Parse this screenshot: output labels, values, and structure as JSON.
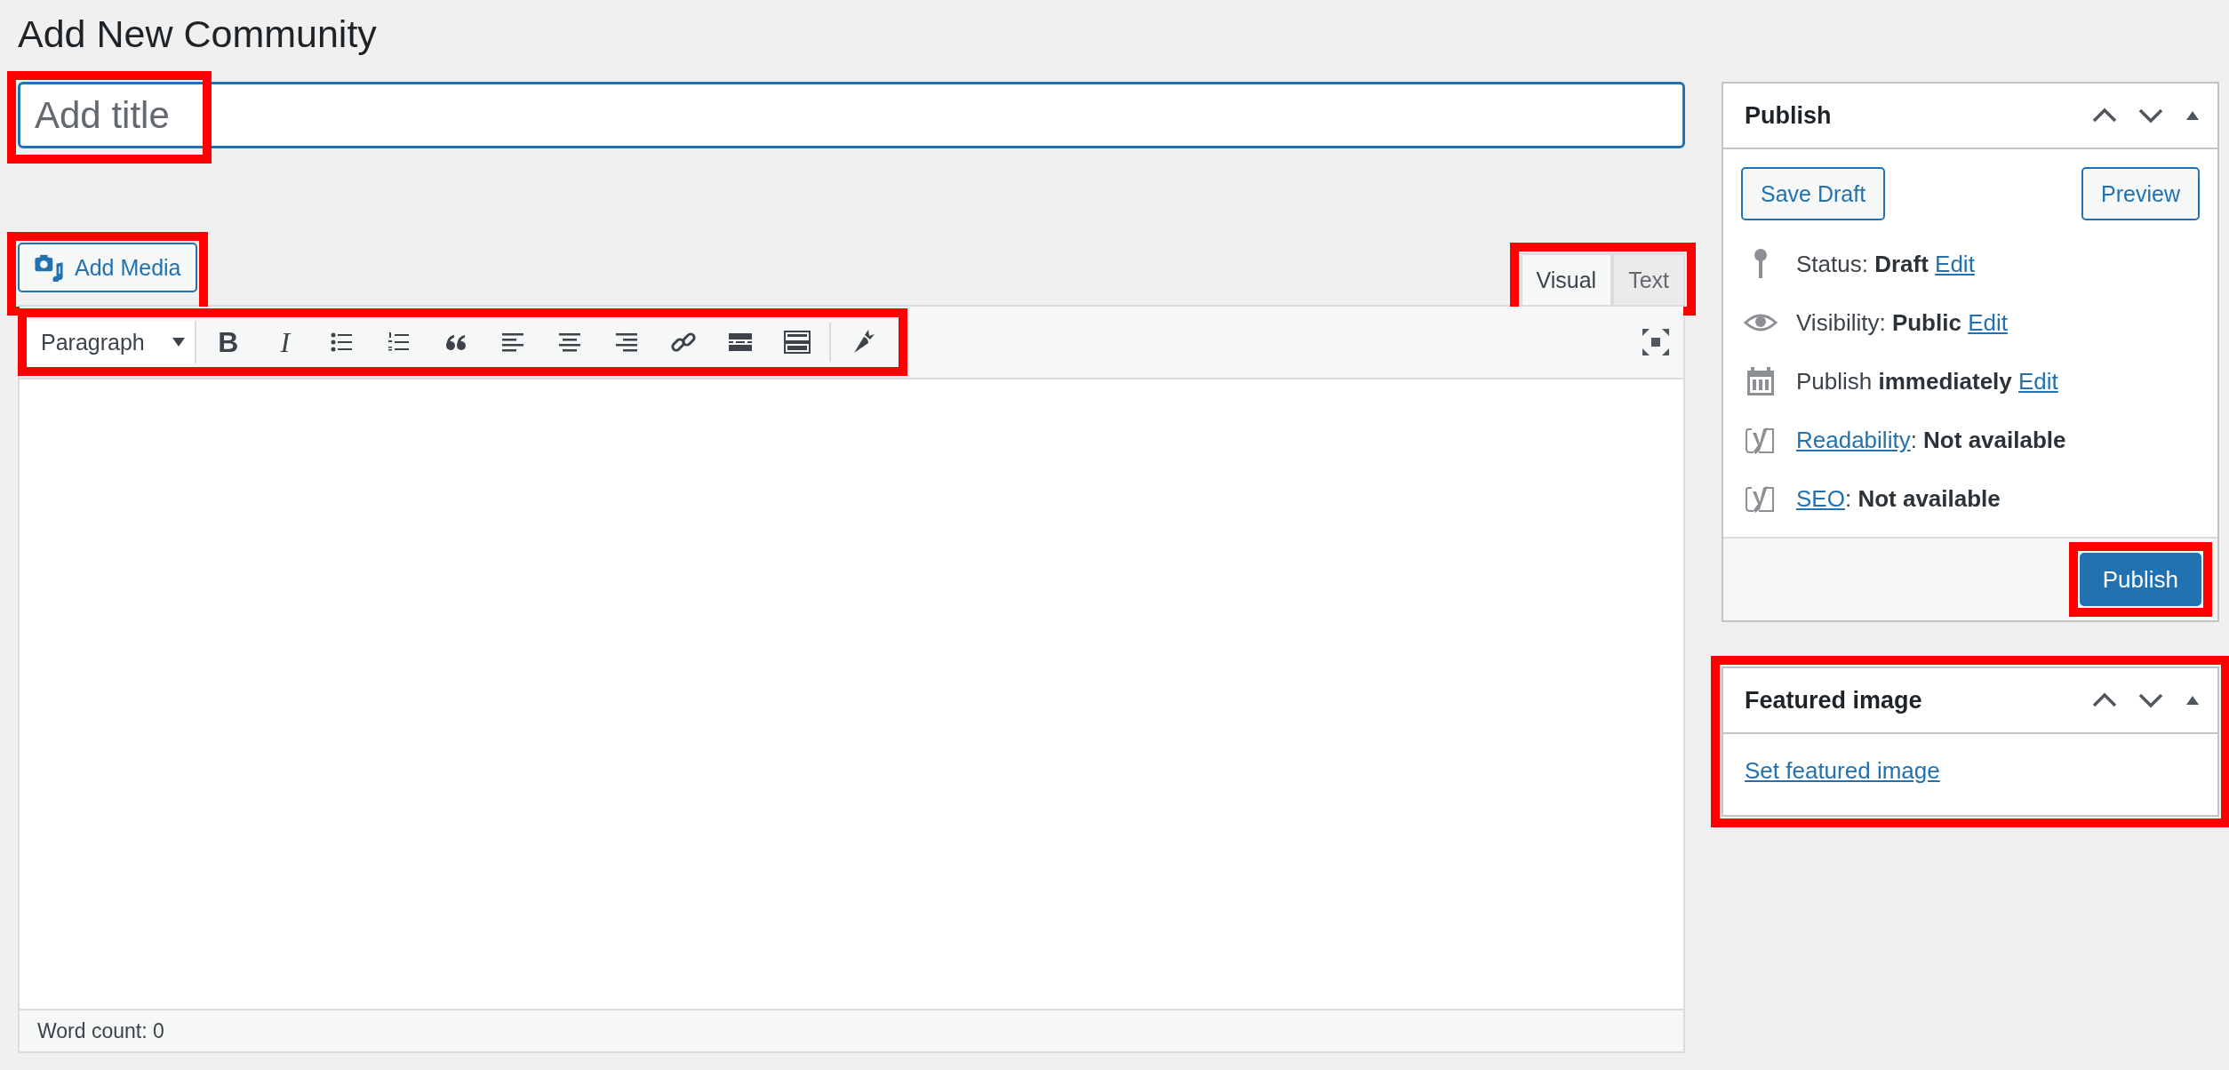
{
  "page_title": "Add New Community",
  "title_field": {
    "placeholder": "Add title",
    "highlighted": true
  },
  "add_media": {
    "label": "Add Media",
    "highlighted": true
  },
  "editor_tabs": {
    "highlighted": true,
    "tabs": [
      {
        "label": "Visual",
        "selected": true
      },
      {
        "label": "Text",
        "selected": false
      }
    ]
  },
  "toolbar": {
    "highlighted": true,
    "format_select": "Paragraph",
    "buttons": [
      {
        "kind": "bold",
        "glyph": "B"
      },
      {
        "kind": "italic",
        "glyph": "I"
      },
      {
        "kind": "bullet-list"
      },
      {
        "kind": "numbered-list"
      },
      {
        "kind": "quote"
      },
      {
        "kind": "align-left"
      },
      {
        "kind": "align-center"
      },
      {
        "kind": "align-right"
      },
      {
        "kind": "link"
      },
      {
        "kind": "more"
      },
      {
        "kind": "toolbar-toggle"
      },
      {
        "kind": "divider"
      },
      {
        "kind": "carrot"
      }
    ]
  },
  "word_count": "Word count: 0",
  "publish_box": {
    "title": "Publish",
    "buttons": [
      "Save Draft",
      "Preview"
    ],
    "rows": [
      {
        "kind": "status",
        "text": "Status: **Draft**",
        "link": "Edit"
      },
      {
        "kind": "visibility",
        "text": "Visibility: **Public**",
        "link": "Edit"
      },
      {
        "kind": "schedule",
        "text": "Publish **immediately**",
        "link": "Edit"
      },
      {
        "kind": "yoast",
        "link": "Readability",
        "text": ": **Not available**"
      },
      {
        "kind": "yoast",
        "link": "SEO",
        "text": ": **Not available**"
      }
    ],
    "publish_button": {
      "label": "Publish",
      "highlighted": true
    }
  },
  "featured_image_box": {
    "title": "Featured image",
    "link": "Set featured image",
    "highlighted": true
  }
}
